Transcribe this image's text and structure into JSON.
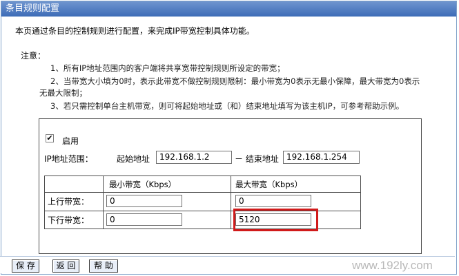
{
  "window": {
    "title": "条目规则配置"
  },
  "intro": "本页通过条目的控制规则进行配置，来完成IP带宽控制具体功能。",
  "notes": {
    "title": "注意：",
    "line1": "1、所有IP地址范围内的客户端将共享宽带控制规则所设定的带宽；",
    "line2": "2、当带宽大小填为0时，表示此带宽不做控制规则限制：最小带宽为0表示无最小保障，最大带宽为0表示",
    "line2b": "无最大限制；",
    "line3": "3、若只需控制单台主机带宽，则可将起始地址或（和）结束地址填写为该主机IP，可参考帮助示例。"
  },
  "rule": {
    "enabled": true,
    "enable_label": "启用",
    "ip_range_label": "IP地址范围：",
    "start_label": "起始地址",
    "start_value": "192.168.1.2",
    "end_label": "－ 结束地址",
    "end_value": "192.168.1.254"
  },
  "bandwidth": {
    "min_header": "最小带宽（Kbps）",
    "max_header": "最大带宽（Kbps）",
    "up_label": "上行带宽：",
    "up_min": "0",
    "up_max": "0",
    "down_label": "下行带宽：",
    "down_min": "0",
    "down_max": "5120"
  },
  "buttons": {
    "save": "保 存",
    "back": "返 回",
    "help": "帮 助"
  },
  "watermark": "www.192ly.com",
  "colors": {
    "titlebar": "#4f7fc4",
    "highlight": "#d11a1a"
  }
}
